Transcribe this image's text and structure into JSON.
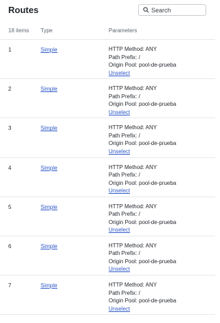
{
  "header": {
    "title": "Routes",
    "search_placeholder": "Search",
    "search_value": ""
  },
  "table": {
    "count_label": "18 items",
    "col_type": "Type",
    "col_params": "Parameters"
  },
  "rows": [
    {
      "index": "1",
      "type": "Simple",
      "method": "HTTP Method: ANY",
      "path": "Path Prefix: /",
      "pool": "Origin Pool: pool-de-prueba",
      "action": "Unselect"
    },
    {
      "index": "2",
      "type": "Simple",
      "method": "HTTP Method: ANY",
      "path": "Path Prefix: /",
      "pool": "Origin Pool: pool-de-prueba",
      "action": "Unselect"
    },
    {
      "index": "3",
      "type": "Simple",
      "method": "HTTP Method: ANY",
      "path": "Path Prefix: /",
      "pool": "Origin Pool: pool-de-prueba",
      "action": "Unselect"
    },
    {
      "index": "4",
      "type": "Simple",
      "method": "HTTP Method: ANY",
      "path": "Path Prefix: /",
      "pool": "Origin Pool: pool-de-prueba",
      "action": "Unselect"
    },
    {
      "index": "5",
      "type": "Simple",
      "method": "HTTP Method: ANY",
      "path": "Path Prefix: /",
      "pool": "Origin Pool: pool-de-prueba",
      "action": "Unselect"
    },
    {
      "index": "6",
      "type": "Simple",
      "method": "HTTP Method: ANY",
      "path": "Path Prefix: /",
      "pool": "Origin Pool: pool-de-prueba",
      "action": "Unselect"
    },
    {
      "index": "7",
      "type": "Simple",
      "method": "HTTP Method: ANY",
      "path": "Path Prefix: /",
      "pool": "Origin Pool: pool-de-prueba",
      "action": "Unselect"
    }
  ]
}
